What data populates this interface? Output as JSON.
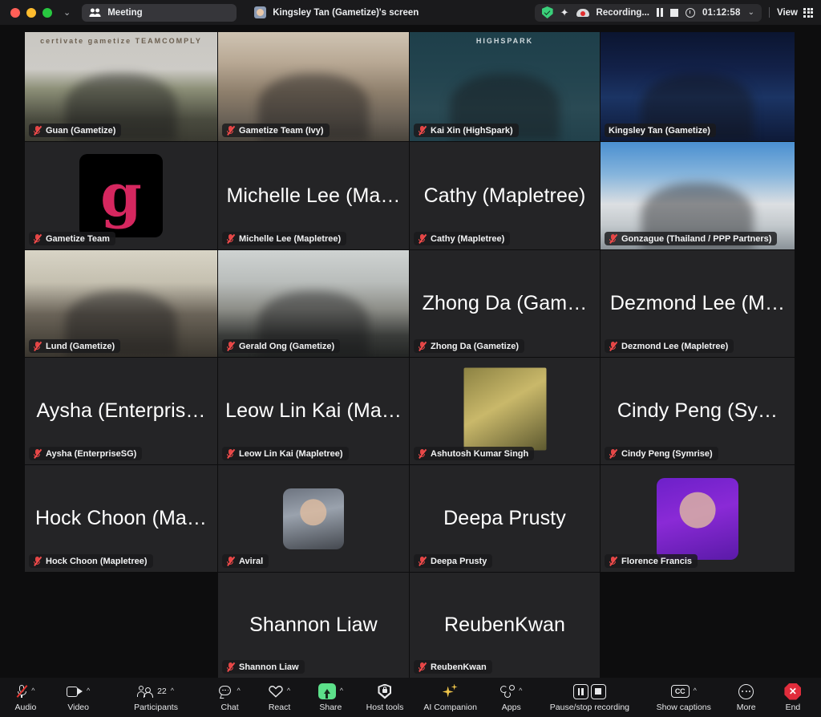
{
  "titlebar": {
    "window_controls": [
      "close",
      "minimize",
      "maximize"
    ],
    "chevron": "⌄",
    "meeting_label": "Meeting",
    "meeting_icon": "people-icon",
    "screen_share_owner": "Kingsley Tan (Gametize)'s screen",
    "encryption_icon": "green-shield-icon",
    "ai_icon": "ai-sparkle-icon",
    "recording_label": "Recording...",
    "pause_icon": "pause-icon",
    "stop_icon": "stop-icon",
    "clock_icon": "clock-icon",
    "timer": "01:12:58",
    "timer_caret": "⌄",
    "view_label": "View",
    "view_icon": "grid-icon"
  },
  "participants": [
    {
      "name": "Guan (Gametize)",
      "muted": true,
      "mode": "camera",
      "speaking": false,
      "row": 0,
      "col": 0,
      "overlay": "certivate gametize TEAMCOMPLY"
    },
    {
      "name": "Gametize Team (Ivy)",
      "muted": true,
      "mode": "camera",
      "speaking": false,
      "row": 0,
      "col": 1
    },
    {
      "name": "Kai Xin (HighSpark)",
      "muted": true,
      "mode": "camera",
      "speaking": false,
      "row": 0,
      "col": 2,
      "overlay": "HIGHSPARK"
    },
    {
      "name": "Kingsley Tan (Gametize)",
      "muted": false,
      "mode": "camera",
      "speaking": true,
      "row": 0,
      "col": 3
    },
    {
      "name": "Gametize Team",
      "muted": true,
      "mode": "avatar-logo",
      "avatar_glyph": "g",
      "speaking": false,
      "row": 1,
      "col": 0
    },
    {
      "name": "Michelle Lee (Mapletree)",
      "display": "Michelle Lee (Ma…",
      "muted": true,
      "mode": "name",
      "speaking": false,
      "row": 1,
      "col": 1
    },
    {
      "name": "Cathy (Mapletree)",
      "display": "Cathy (Mapletree)",
      "muted": true,
      "mode": "name",
      "speaking": false,
      "row": 1,
      "col": 2
    },
    {
      "name": "Gonzague (Thailand / PPP Partners)",
      "muted": true,
      "mode": "camera",
      "speaking": false,
      "row": 1,
      "col": 3
    },
    {
      "name": "Lund (Gametize)",
      "muted": true,
      "mode": "camera",
      "speaking": false,
      "row": 2,
      "col": 0
    },
    {
      "name": "Gerald Ong (Gametize)",
      "muted": true,
      "mode": "camera",
      "speaking": false,
      "row": 2,
      "col": 1
    },
    {
      "name": "Zhong Da (Gametize)",
      "display": "Zhong Da (Gam…",
      "muted": true,
      "mode": "name",
      "speaking": false,
      "row": 2,
      "col": 2
    },
    {
      "name": "Dezmond Lee (Mapletree)",
      "display": "Dezmond Lee (M…",
      "muted": true,
      "mode": "name",
      "speaking": false,
      "row": 2,
      "col": 3
    },
    {
      "name": "Aysha (EnterpriseSG)",
      "display": "Aysha (Enterpris…",
      "muted": true,
      "mode": "name",
      "speaking": false,
      "row": 3,
      "col": 0
    },
    {
      "name": "Leow Lin Kai (Mapletree)",
      "display": "Leow Lin Kai (Ma…",
      "muted": true,
      "mode": "name",
      "speaking": false,
      "row": 3,
      "col": 1
    },
    {
      "name": "Ashutosh Kumar Singh",
      "muted": true,
      "mode": "avatar-photo",
      "speaking": false,
      "row": 3,
      "col": 2
    },
    {
      "name": "Cindy Peng (Symrise)",
      "display": "Cindy Peng (Sy…",
      "muted": true,
      "mode": "name",
      "speaking": false,
      "row": 3,
      "col": 3
    },
    {
      "name": "Hock Choon (Mapletree)",
      "display": "Hock Choon (Ma…",
      "muted": true,
      "mode": "name",
      "speaking": false,
      "row": 4,
      "col": 0
    },
    {
      "name": "Aviral",
      "muted": true,
      "mode": "avatar-photo",
      "speaking": false,
      "row": 4,
      "col": 1
    },
    {
      "name": "Deepa Prusty",
      "display": "Deepa Prusty",
      "muted": true,
      "mode": "name",
      "speaking": false,
      "row": 4,
      "col": 2
    },
    {
      "name": "Florence Francis",
      "muted": true,
      "mode": "avatar-photo",
      "speaking": false,
      "row": 4,
      "col": 3
    },
    {
      "name": "Shannon Liaw",
      "display": "Shannon Liaw",
      "muted": true,
      "mode": "name",
      "speaking": false,
      "row": 5,
      "col": 1
    },
    {
      "name": "ReubenKwan",
      "display": "ReubenKwan",
      "muted": true,
      "mode": "name",
      "speaking": false,
      "row": 5,
      "col": 2
    }
  ],
  "toolbar": {
    "items": [
      {
        "label": "Audio",
        "icon": "microphone-muted-icon",
        "caret": true
      },
      {
        "label": "Video",
        "icon": "camera-icon",
        "caret": true
      },
      {
        "label": "Participants",
        "icon": "participants-icon",
        "caret": true,
        "badge": "22"
      },
      {
        "label": "Chat",
        "icon": "chat-bubble-icon",
        "caret": true
      },
      {
        "label": "React",
        "icon": "heart-icon",
        "caret": true
      },
      {
        "label": "Share",
        "icon": "share-screen-icon",
        "caret": true,
        "accent": "#5ce08a"
      },
      {
        "label": "Host tools",
        "icon": "shield-lock-icon",
        "caret": false
      },
      {
        "label": "AI Companion",
        "icon": "ai-sparkle-icon",
        "caret": false,
        "accent": "#f0c64a"
      },
      {
        "label": "Apps",
        "icon": "apps-icon",
        "caret": true
      },
      {
        "label": "Pause/stop recording",
        "icon": "pause-stop-recording-icon",
        "caret": false
      },
      {
        "label": "Show captions",
        "icon": "closed-captions-icon",
        "caret": true
      },
      {
        "label": "More",
        "icon": "more-ellipsis-icon",
        "caret": false
      },
      {
        "label": "End",
        "icon": "end-call-icon",
        "caret": false,
        "accent": "#e02d3c"
      }
    ],
    "cc_text": "CC"
  },
  "colors": {
    "titlebar_bg": "#1a1a1c",
    "stage_bg": "#0d0d0e",
    "tile_bg": "#242426",
    "toolbar_bg": "#141416",
    "speaking_border": "#49d66b",
    "share_accent": "#5ce08a",
    "end_accent": "#e02d3c",
    "mute_red": "#e34545",
    "gametize_pink": "#d5275f"
  }
}
